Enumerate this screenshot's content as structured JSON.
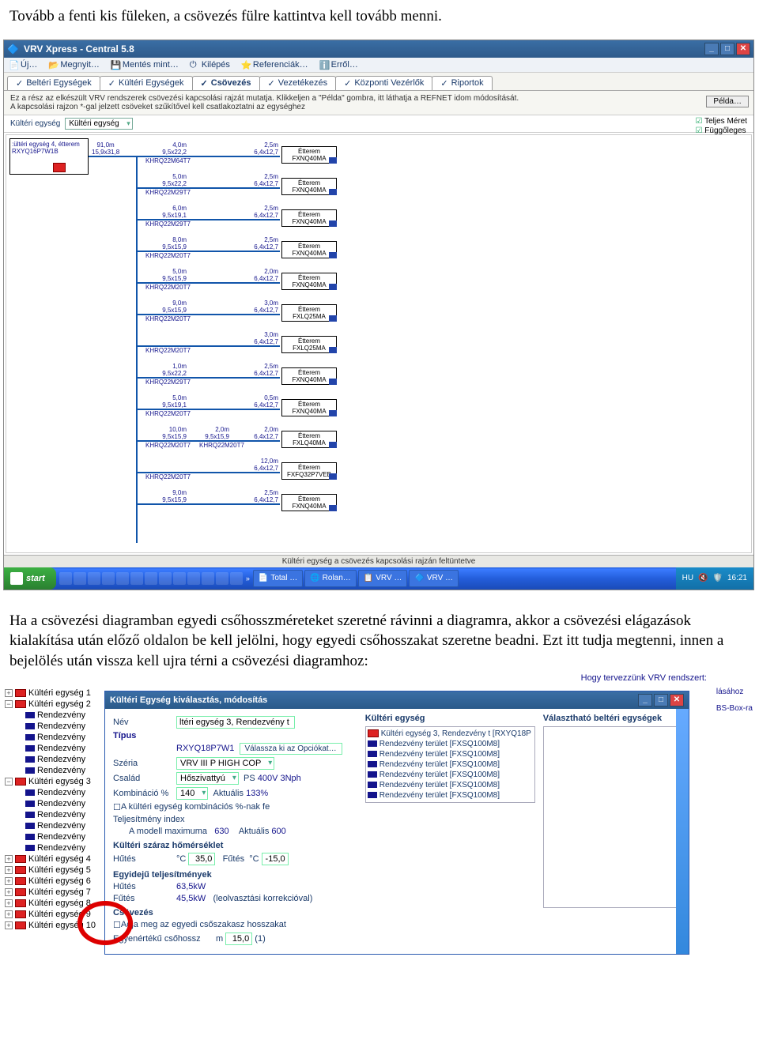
{
  "doc": {
    "para_top": "Tovább a fenti kis füleken, a csövezés fülre kattintva kell tovább menni.",
    "para_mid": "Ha a csövezési diagramban egyedi csőhosszméreteket szeretné rávinni a diagramra, akkor a csövezési elágazások kialakítása után előző oldalon be kell jelölni, hogy egyedi csőhosszakat szeretne beadni. Ezt itt tudja megtenni, innen a bejelölés után vissza kell ujra térni a csövezési diagramhoz:"
  },
  "s1": {
    "title": "VRV Xpress - Central 5.8",
    "toolbar": {
      "new": "Új…",
      "open": "Megnyit…",
      "saveas": "Mentés mint…",
      "exit": "Kilépés",
      "refs": "Referenciák…",
      "about": "Erről…"
    },
    "tabs": {
      "indoor": "Beltéri Egységek",
      "outdoor": "Kültéri Egységek",
      "piping": "Csövezés",
      "wiring": "Vezetékezés",
      "ctrl": "Központi Vezérlők",
      "reports": "Riportok"
    },
    "info1": "Ez a rész az elkészült VRV rendszerek csövezési kapcsolási rajzát mutatja. Klikkeljen a \"Példa\" gombra, itt láthatja a REFNET idom módosítását.",
    "info2": "A kapcsolási rajzon *-gal jelzett csöveket szűkítővel kell csatlakoztatni az egységhez",
    "pelda_btn": "Példa…",
    "opt_label": "Kültéri egység",
    "opt_value": "Kültéri egység",
    "chk1": "Teljes Méret",
    "chk2": "Függőleges",
    "outdoor_unit": {
      "header": ":ültéri egység 4, étterem",
      "model": "RXYQ16P7W1B",
      "pipe_a": "91,0m",
      "pipe_b": "15,9x31,8"
    },
    "refnets": [
      "KHRQ22M64T7",
      "KHRQ22M29T7",
      "KHRQ22M29T7",
      "KHRQ22M20T7",
      "KHRQ22M20T7",
      "KHRQ22M20T7",
      "KHRQ22M20T7",
      "KHRQ22M29T7",
      "KHRQ22M20T7",
      "KHRQ22M20T7",
      "KHRQ22M20T7"
    ],
    "branches": [
      {
        "len": "4,0m",
        "size": "9,5x22,2",
        "blen": "2,5m",
        "bsize": "6,4x12,7",
        "room": "Étterem",
        "model": "FXNQ40MA"
      },
      {
        "len": "5,0m",
        "size": "9,5x22,2",
        "blen": "2,5m",
        "bsize": "6,4x12,7",
        "room": "Étterem",
        "model": "FXNQ40MA"
      },
      {
        "len": "6,0m",
        "size": "9,5x19,1",
        "blen": "2,5m",
        "bsize": "6,4x12,7",
        "room": "Étterem",
        "model": "FXNQ40MA"
      },
      {
        "len": "8,0m",
        "size": "9,5x15,9",
        "blen": "2,5m",
        "bsize": "6,4x12,7",
        "room": "Étterem",
        "model": "FXNQ40MA"
      },
      {
        "len": "5,0m",
        "size": "9,5x15,9",
        "blen": "2,0m",
        "bsize": "6,4x12,7",
        "room": "Étterem",
        "model": "FXNQ40MA"
      },
      {
        "len": "9,0m",
        "size": "9,5x15,9",
        "blen": "3,0m",
        "bsize": "6,4x12,7",
        "room": "Étterem",
        "model": "FXLQ25MA"
      },
      {
        "len": "",
        "size": "",
        "blen": "3,0m",
        "bsize": "6,4x12,7",
        "room": "Étterem",
        "model": "FXLQ25MA"
      },
      {
        "len": "1,0m",
        "size": "9,5x22,2",
        "blen": "2,5m",
        "bsize": "6,4x12,7",
        "room": "Étterem",
        "model": "FXNQ40MA"
      },
      {
        "len": "5,0m",
        "size": "9,5x19,1",
        "blen": "0,5m",
        "bsize": "6,4x12,7",
        "room": "Étterem",
        "model": "FXNQ40MA"
      },
      {
        "len": "10,0m",
        "size": "9,5x15,9",
        "blen": "2,0m",
        "bsize": "6,4x12,7",
        "room": "Étterem",
        "model": "FXLQ40MA",
        "mid": "2,0m",
        "midsize": "9,5x15,9",
        "midref": "KHRQ22M20T7"
      },
      {
        "len": "",
        "size": "",
        "blen": "12,0m",
        "bsize": "6,4x12,7",
        "room": "Étterem",
        "model": "FXFQ32P7VEB"
      },
      {
        "len": "9,0m",
        "size": "9,5x15,9",
        "blen": "2,5m",
        "bsize": "6,4x12,7",
        "room": "Étterem",
        "model": "FXNQ40MA"
      }
    ],
    "statusbar": "Kültéri egység a csövezés kapcsolási rajzán feltüntetve",
    "taskbar": {
      "start": "start",
      "tasks": [
        "Total …",
        "Rolan…",
        "VRV …",
        "VRV …"
      ],
      "lang": "HU",
      "clock": "16:21"
    }
  },
  "s2": {
    "side_hint1": "lásához",
    "side_hint2": "BS-Box-ra",
    "side_hint_top": "Hogy tervezzünk VRV rendszert:",
    "tree": {
      "ku1": "Kültéri egység 1",
      "ku2": "Kültéri egység 2",
      "rend": "Rendezvény",
      "ku3": "Kültéri egység 3",
      "ku4": "Kültéri egység 4",
      "ku5": "Kültéri egység 5",
      "ku6": "Kültéri egység 6",
      "ku7": "Kültéri egység 7",
      "ku8": "Kültéri egység 8",
      "ku9": "Kültéri egység 9",
      "ku10": "Kültéri egység 10"
    },
    "dlg": {
      "title": "Kültéri Egység kiválasztás, módosítás",
      "lbl_name": "Név",
      "name_val": "ltéri egység 3, Rendezvény t",
      "lbl_type": "Típus",
      "type_val": "RXYQ18P7W1",
      "btn_opts": "Válassza ki az Opciókat…",
      "lbl_series": "Széria",
      "series_val": "VRV III P HIGH COP",
      "lbl_family": "Család",
      "family_val": "Hőszivattyú",
      "lbl_ps": "PS",
      "ps_val": "400V 3Nph",
      "lbl_combo": "Kombináció %",
      "combo_val": "140",
      "lbl_actual": "Aktuális",
      "actual_val": "133%",
      "chk_combo": "A kültéri egység kombinációs %-nak fe",
      "lbl_perfidx": "Teljesítmény index",
      "lbl_modelmax": "A modell maximuma",
      "modelmax_val": "630",
      "lbl_actual2": "Aktuális",
      "actual2_val": "600",
      "hdr_drytemp": "Kültéri száraz hőmérséklet",
      "lbl_cool": "Hűtés",
      "lbl_heat": "Fűtés",
      "unit_c": "°C",
      "cool_val": "35,0",
      "heat_val": "-15,0",
      "hdr_simul": "Egyidejű teljesítmények",
      "cool_kw": "63,5kW",
      "heat_kw": "45,5kW",
      "defrost": "(leolvasztási korrekcióval)",
      "hdr_piping": "Csövezés",
      "chk_piping": "Adja meg az egyedi csőszakasz hosszakat",
      "lbl_equiv": "Egyenértékű csőhossz",
      "unit_m": "m",
      "equiv_val": "15,0",
      "equiv_extra": "(1)"
    },
    "col2": {
      "hdr": "Kültéri egység",
      "parent": "Kültéri egység 3, Rendezvény t [RXYQ18P",
      "items": [
        "Rendezvény terület [FXSQ100M8]",
        "Rendezvény terület [FXSQ100M8]",
        "Rendezvény terület [FXSQ100M8]",
        "Rendezvény terület [FXSQ100M8]",
        "Rendezvény terület [FXSQ100M8]",
        "Rendezvény terület [FXSQ100M8]"
      ]
    },
    "col3": {
      "hdr": "Választható beltéri egységek"
    }
  }
}
